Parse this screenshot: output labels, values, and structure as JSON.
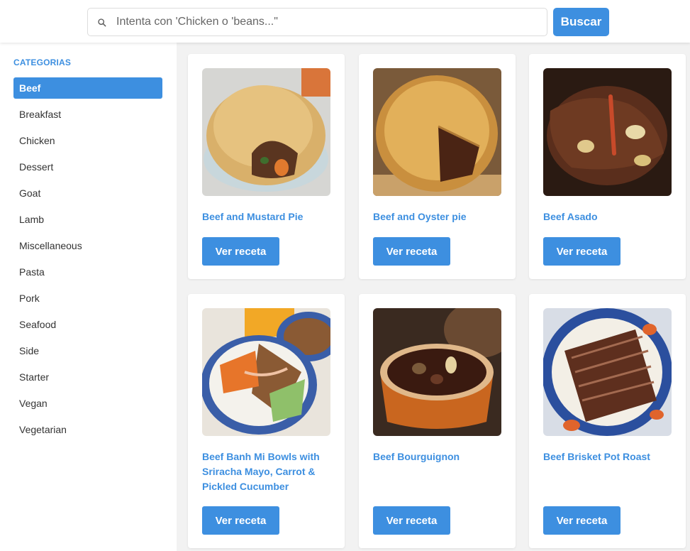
{
  "search": {
    "placeholder": "Intenta con 'Chicken o 'beans...\"",
    "button_label": "Buscar"
  },
  "sidebar": {
    "title": "CATEGORIAS",
    "items": [
      {
        "label": "Beef",
        "active": true
      },
      {
        "label": "Breakfast"
      },
      {
        "label": "Chicken"
      },
      {
        "label": "Dessert"
      },
      {
        "label": "Goat"
      },
      {
        "label": "Lamb"
      },
      {
        "label": "Miscellaneous"
      },
      {
        "label": "Pasta"
      },
      {
        "label": "Pork"
      },
      {
        "label": "Seafood"
      },
      {
        "label": "Side"
      },
      {
        "label": "Starter"
      },
      {
        "label": "Vegan"
      },
      {
        "label": "Vegetarian"
      }
    ]
  },
  "recipes": [
    {
      "title": "Beef and Mustard Pie",
      "button_label": "Ver receta"
    },
    {
      "title": "Beef and Oyster pie",
      "button_label": "Ver receta"
    },
    {
      "title": "Beef Asado",
      "button_label": "Ver receta"
    },
    {
      "title": "Beef Banh Mi Bowls with Sriracha Mayo, Carrot & Pickled Cucumber",
      "button_label": "Ver receta"
    },
    {
      "title": "Beef Bourguignon",
      "button_label": "Ver receta"
    },
    {
      "title": "Beef Brisket Pot Roast",
      "button_label": "Ver receta"
    }
  ],
  "colors": {
    "accent": "#3d8fe0",
    "background": "#f2f2f2"
  }
}
